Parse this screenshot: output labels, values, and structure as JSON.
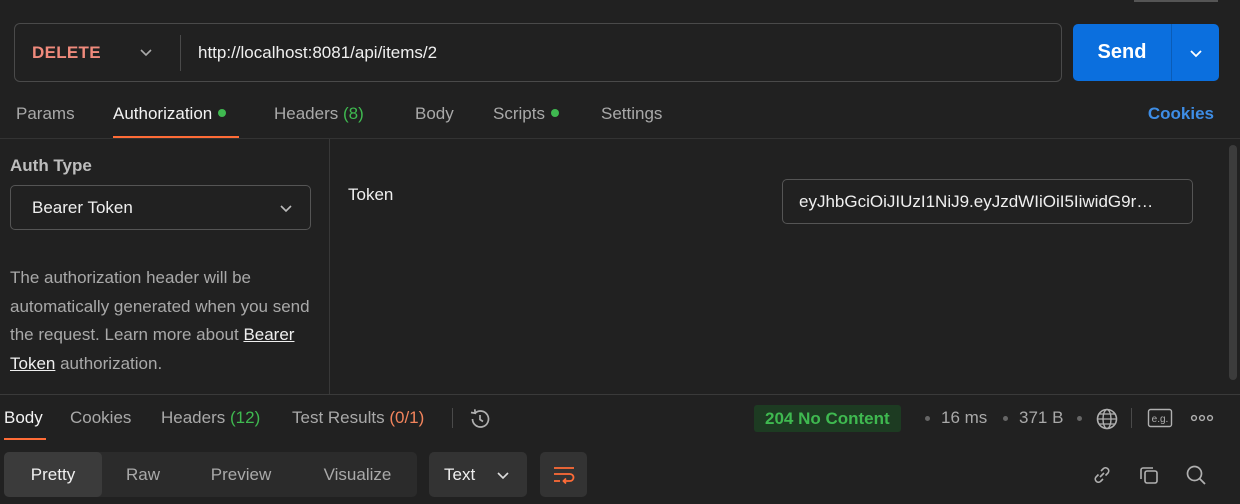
{
  "request": {
    "method": "DELETE",
    "url": "http://localhost:8081/api/items/2",
    "send_label": "Send"
  },
  "request_tabs": {
    "params": "Params",
    "authorization": "Authorization",
    "headers": "Headers",
    "headers_count": "(8)",
    "body": "Body",
    "scripts": "Scripts",
    "settings": "Settings",
    "cookies": "Cookies"
  },
  "auth": {
    "type_label": "Auth Type",
    "type_value": "Bearer Token",
    "description_prefix": "The authorization header will be automatically generated when you send the request. Learn more about ",
    "description_link": "Bearer Token",
    "description_suffix": " authorization.",
    "token_label": "Token",
    "token_value": "eyJhbGciOiJIUzI1NiJ9.eyJzdWIiOiI5IiwidG9r…"
  },
  "response_tabs": {
    "body": "Body",
    "cookies": "Cookies",
    "headers": "Headers",
    "headers_count": "(12)",
    "test_results": "Test Results",
    "test_results_count": "(0/1)"
  },
  "response_meta": {
    "status": "204 No Content",
    "time": "16 ms",
    "size": "371 B",
    "eg_label": "e.g."
  },
  "response_view": {
    "modes": [
      "Pretty",
      "Raw",
      "Preview",
      "Visualize"
    ],
    "format": "Text"
  },
  "colors": {
    "accent": "#ff6c37",
    "send": "#0b6fde",
    "method_delete": "#f08a7c",
    "success": "#3fb950",
    "link": "#3e8de5"
  },
  "icons": [
    "chevron-down-icon",
    "history-icon",
    "globe-icon",
    "example-icon",
    "more-icon",
    "wrap-lines-icon",
    "link-icon",
    "copy-icon",
    "search-icon"
  ]
}
